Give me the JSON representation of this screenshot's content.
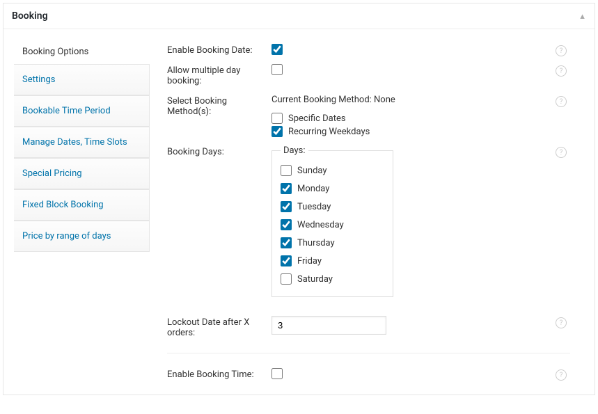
{
  "panel": {
    "title": "Booking"
  },
  "sidebar": {
    "header": "Booking Options",
    "items": [
      {
        "label": "Settings"
      },
      {
        "label": "Bookable Time Period"
      },
      {
        "label": "Manage Dates, Time Slots"
      },
      {
        "label": "Special Pricing"
      },
      {
        "label": "Fixed Block Booking"
      },
      {
        "label": "Price by range of days"
      }
    ]
  },
  "form": {
    "enable_booking_date": {
      "label": "Enable Booking Date:"
    },
    "allow_multiple": {
      "label": "Allow multiple day booking:"
    },
    "select_method": {
      "label": "Select Booking Method(s):",
      "status": "Current Booking Method: None",
      "opt1": "Specific Dates",
      "opt2": "Recurring Weekdays"
    },
    "booking_days": {
      "label": "Booking Days:",
      "legend": "Days:",
      "days": {
        "sun": "Sunday",
        "mon": "Monday",
        "tue": "Tuesday",
        "wed": "Wednesday",
        "thu": "Thursday",
        "fri": "Friday",
        "sat": "Saturday"
      }
    },
    "lockout": {
      "label": "Lockout Date after X orders:",
      "value": "3"
    },
    "enable_booking_time": {
      "label": "Enable Booking Time:"
    }
  }
}
